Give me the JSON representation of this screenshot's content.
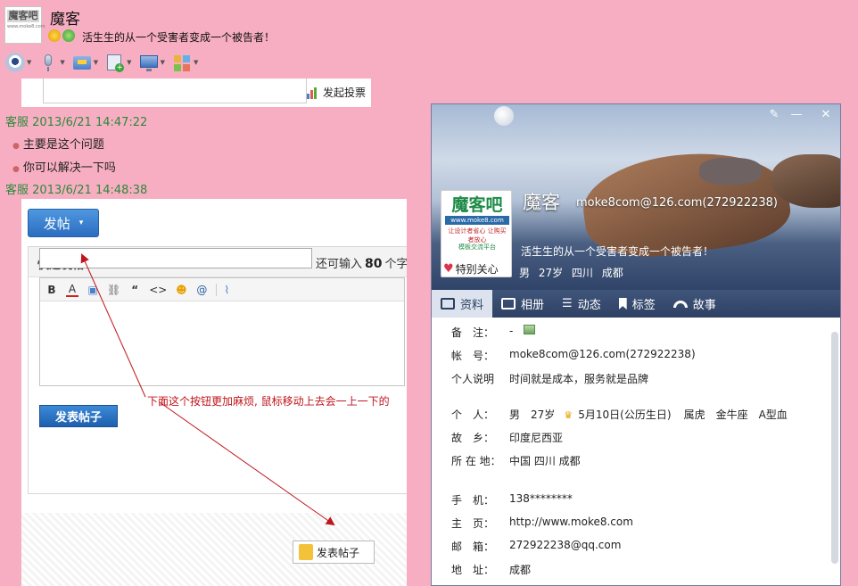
{
  "chat": {
    "contact_name": "魔客",
    "status_message": "活生生的从一个受害者变成一个被告者！",
    "avatar_logo": "魔客吧",
    "avatar_url": "www.moke8.com"
  },
  "toolbar": {
    "items": [
      "video-call-icon",
      "voice-call-icon",
      "send-file-icon",
      "add-note-icon",
      "remote-desktop-icon",
      "apps-icon"
    ]
  },
  "top_strip": {
    "vote_label": "发起投票"
  },
  "messages": [
    {
      "sender": "客服",
      "time": "2013/6/21 14:47:22",
      "lines": [
        "主要是这个问题",
        "你可以解决一下吗"
      ]
    },
    {
      "sender": "客服",
      "time": "2013/6/21 14:48:38",
      "lines": []
    }
  ],
  "forum": {
    "post_button": "发帖",
    "post_caret": "▾",
    "quick_post_title": "快速发帖",
    "remaining_prefix": "还可输入",
    "remaining_count": "80",
    "remaining_suffix": "个字",
    "editor_tools": [
      "B",
      "A",
      "▣",
      "⛓",
      "“",
      "<>",
      "☻",
      "@",
      "⌇"
    ],
    "submit_label": "发表帖子",
    "annotation": "下面这个按钮更加麻烦, 鼠标移动上去会一上一下的",
    "floating_post_label": "发表帖子"
  },
  "profile": {
    "logo": "魔客吧",
    "logo_url": "www.moke8.com",
    "logo_tag1": "让设计者省心 让购买者放心",
    "logo_tag2": "模板交流平台",
    "special_care": "特别关心",
    "name": "魔客",
    "email_header": "moke8com@126.com(272922238)",
    "signature": "活生生的从一个受害者变成一个被告者！",
    "basic": "男  27岁  四川 成都",
    "tabs": [
      {
        "label": "资料",
        "active": true
      },
      {
        "label": "相册",
        "active": false
      },
      {
        "label": "动态",
        "active": false
      },
      {
        "label": "标签",
        "active": false
      },
      {
        "label": "故事",
        "active": false
      }
    ],
    "fields": {
      "note_key": "备　注：",
      "note_val": "-",
      "account_key": "帐　号：",
      "account_val": "moke8com@126.com(272922238)",
      "desc_key": "个人说明",
      "desc_val": "时间就是成本，服务就是品牌",
      "person_key": "个　人：",
      "person_val": "男　27岁",
      "person_birthday": "5月10日(公历生日)",
      "person_extra": "属虎　金牛座　A型血",
      "hometown_key": "故　乡：",
      "hometown_val": "印度尼西亚",
      "location_key": "所 在 地：",
      "location_val": "中国 四川 成都",
      "mobile_key": "手　机：",
      "mobile_val": "138********",
      "home_key": "主　页：",
      "home_val": "http://www.moke8.com",
      "mail_key": "邮　箱：",
      "mail_val": "272922238@qq.com",
      "addr_key": "地　址：",
      "addr_val": "成都"
    }
  }
}
